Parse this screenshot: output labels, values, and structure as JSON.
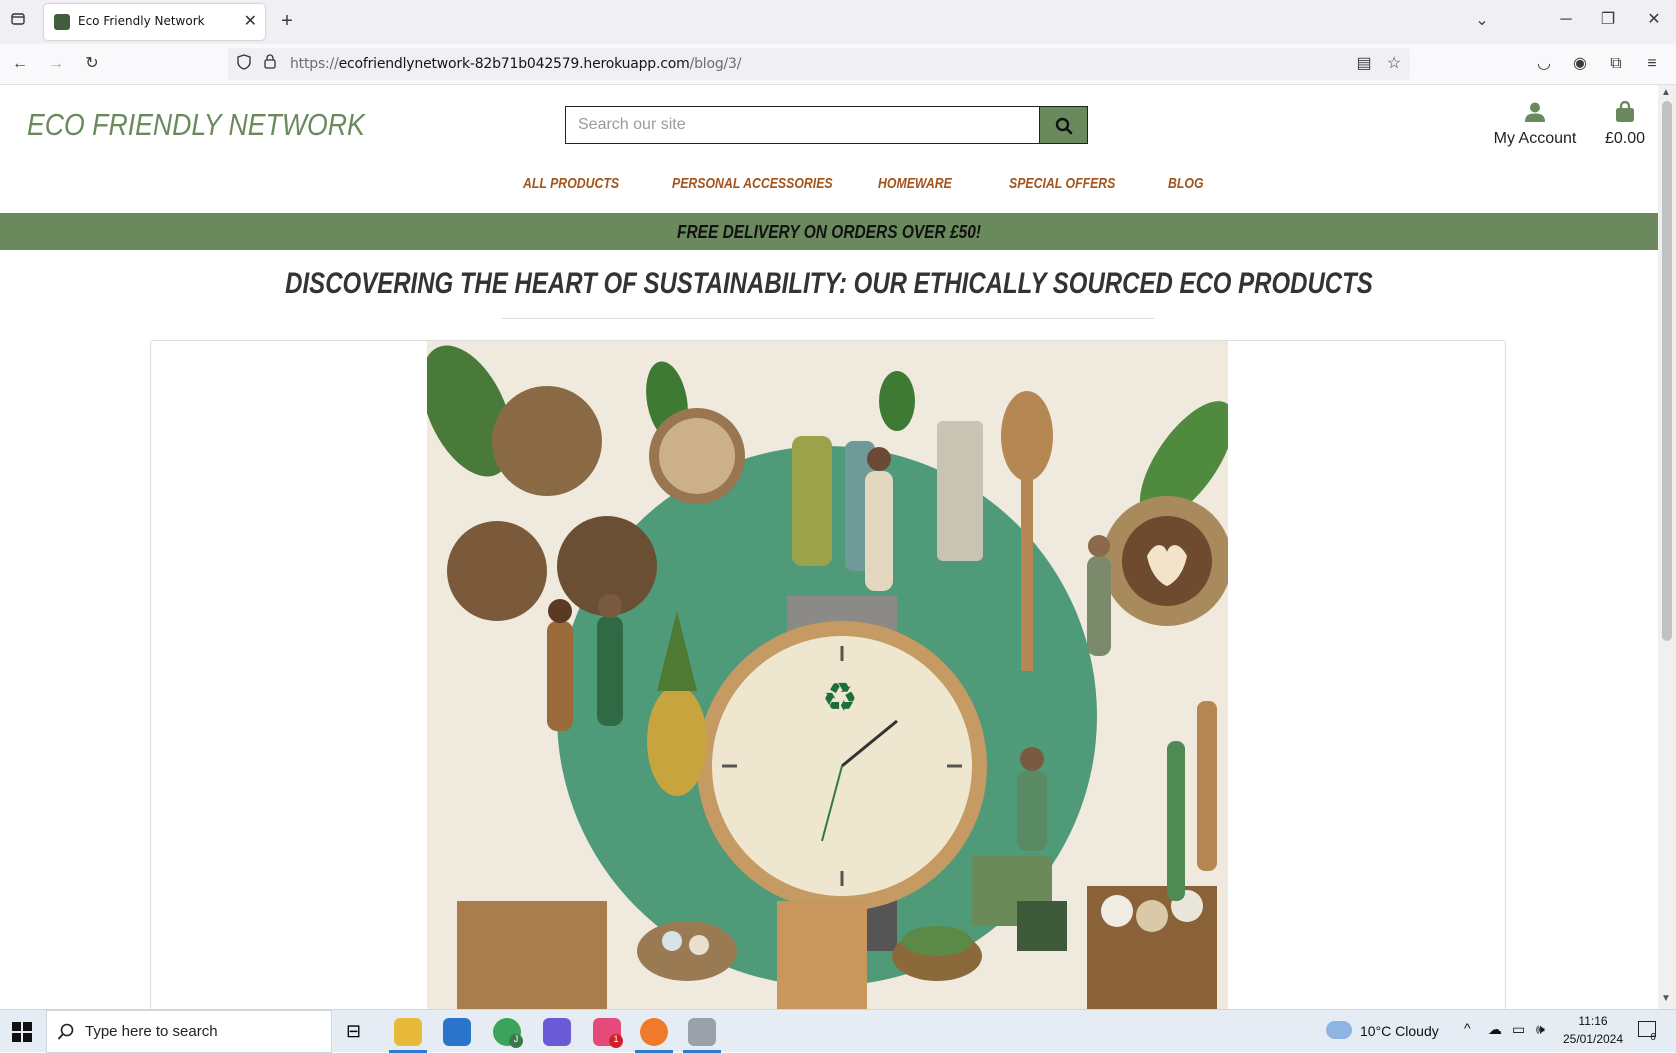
{
  "browser": {
    "tab_title": "Eco Friendly Network",
    "url_prefix": "https://",
    "url_host": "ecofriendlynetwork-82b71b042579.herokuapp.com",
    "url_path": "/blog/3/"
  },
  "header": {
    "logo": "ECO FRIENDLY NETWORK",
    "search_placeholder": "Search our site",
    "account_label": "My Account",
    "cart_total": "£0.00"
  },
  "nav": {
    "items": [
      {
        "label": "ALL PRODUCTS"
      },
      {
        "label": "PERSONAL ACCESSORIES"
      },
      {
        "label": "HOMEWARE"
      },
      {
        "label": "SPECIAL OFFERS"
      },
      {
        "label": "BLOG"
      }
    ]
  },
  "banner": {
    "text": "FREE DELIVERY ON ORDERS OVER £50!"
  },
  "post": {
    "title": "DISCOVERING THE HEART OF SUSTAINABILITY: OUR ETHICALLY SOURCED ECO PRODUCTS"
  },
  "taskbar": {
    "search_placeholder": "Type here to search",
    "weather": "10°C  Cloudy",
    "time": "11:16",
    "date": "25/01/2024",
    "notification_count": "6",
    "chrome_badge": "J",
    "slack_badge": "1"
  },
  "colors": {
    "brand_green": "#6a8a5e",
    "nav_orange": "#a3541c"
  }
}
